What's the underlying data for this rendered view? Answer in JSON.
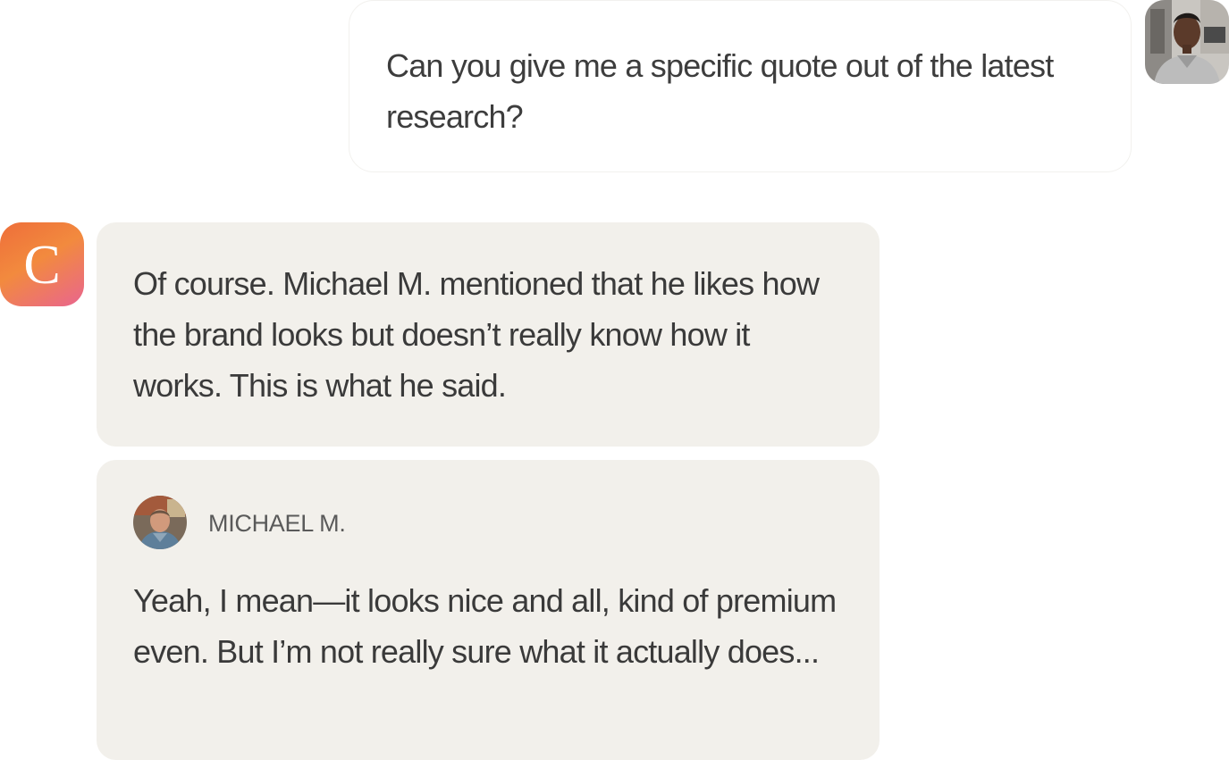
{
  "user_message": {
    "text": "Can you give me a specific quote out of the latest research?",
    "avatar": "user-photo-avatar"
  },
  "assistant": {
    "avatar_letter": "C",
    "avatar_colors": [
      "#ee6e3a",
      "#f28a3e",
      "#e9658f"
    ],
    "message": "Of course. Michael M. mentioned that he likes how the brand looks but doesn’t really know how it works. This is what he said."
  },
  "quote": {
    "author": "MICHAEL M.",
    "text": "Yeah, I mean—it looks nice and all, kind of premium even. But I’m not really sure what it actually does...",
    "avatar": "michael-photo-avatar"
  },
  "colors": {
    "bubble_background": "#f2f0eb",
    "text": "#3a3a3a",
    "author_text": "#5a5a5a"
  }
}
